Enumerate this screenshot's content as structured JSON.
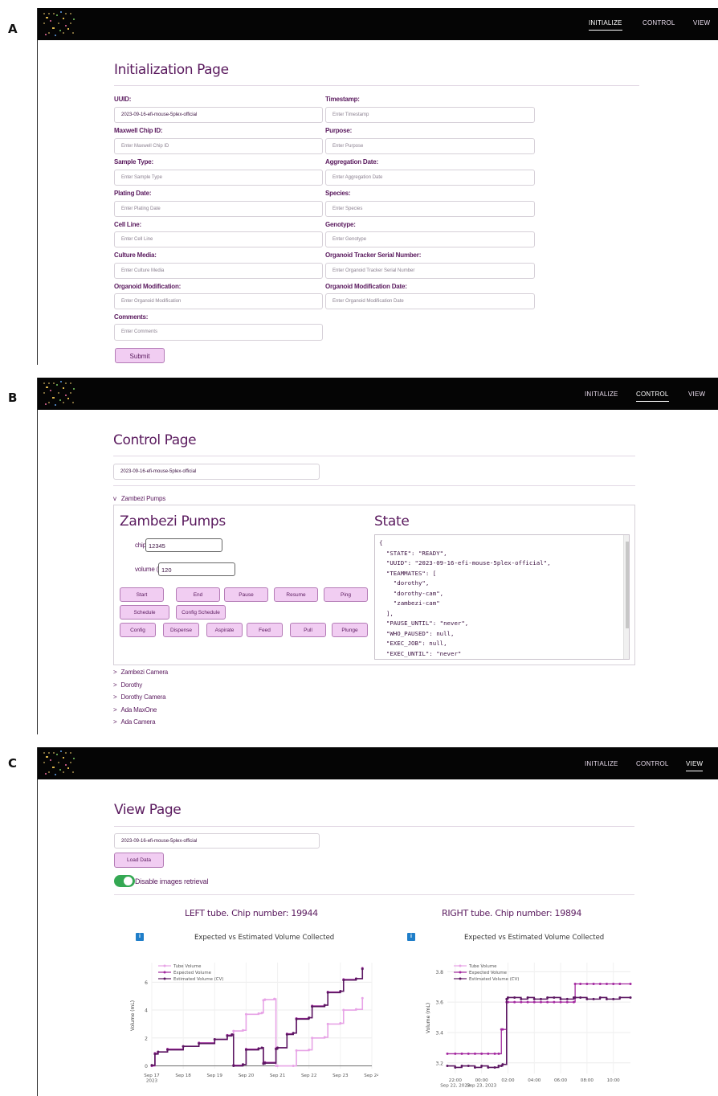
{
  "panels": {
    "a": "A",
    "b": "B",
    "c": "C"
  },
  "nav": {
    "initialize": "INITIALIZE",
    "control": "CONTROL",
    "view": "VIEW"
  },
  "init_page": {
    "title": "Initialization Page",
    "fields_left": [
      {
        "label": "UUID:",
        "value": "2023-09-16-efi-mouse-5plex-official",
        "placeholder": ""
      },
      {
        "label": "Maxwell Chip ID:",
        "value": "",
        "placeholder": "Enter Maxwell Chip ID"
      },
      {
        "label": "Sample Type:",
        "value": "",
        "placeholder": "Enter Sample Type"
      },
      {
        "label": "Plating Date:",
        "value": "",
        "placeholder": "Enter Plating Date"
      },
      {
        "label": "Cell Line:",
        "value": "",
        "placeholder": "Enter Cell Line"
      },
      {
        "label": "Culture Media:",
        "value": "",
        "placeholder": "Enter Culture Media"
      },
      {
        "label": "Organoid Modification:",
        "value": "",
        "placeholder": "Enter Organoid Modification"
      }
    ],
    "fields_right": [
      {
        "label": "Timestamp:",
        "placeholder": "Enter Timestamp"
      },
      {
        "label": "Purpose:",
        "placeholder": "Enter Purpose"
      },
      {
        "label": "Aggregation Date:",
        "placeholder": "Enter Aggregation Date"
      },
      {
        "label": "Species:",
        "placeholder": "Enter Species"
      },
      {
        "label": "Genotype:",
        "placeholder": "Enter Genotype"
      },
      {
        "label": "Organoid Tracker Serial Number:",
        "placeholder": "Enter Organoid Tracker Serial Number"
      },
      {
        "label": "Organoid Modification Date:",
        "placeholder": "Enter Organoid Modification Date"
      }
    ],
    "comments_label": "Comments:",
    "comments_placeholder": "Enter Comments",
    "submit": "Submit"
  },
  "control_page": {
    "title": "Control Page",
    "uuid": "2023-09-16-efi-mouse-5plex-official",
    "accordion_open": "Zambezi Pumps",
    "open_marker": "v",
    "closed_marker": ">",
    "pumps_title": "Zambezi Pumps",
    "chip_id_label": "chip id:",
    "chip_id_value": "12345",
    "volume_label": "volume (uL):",
    "volume_value": "120",
    "buttons_row1": [
      "Start",
      "End",
      "Pause",
      "Resume",
      "Ping"
    ],
    "buttons_row2": [
      "Schedule",
      "Config Schedule"
    ],
    "buttons_row3": [
      "Config",
      "Dispense",
      "Aspirate",
      "Feed",
      "Pull",
      "Plunge"
    ],
    "state_title": "State",
    "state_lines": [
      "{",
      "  \"STATE\": \"READY\",",
      "  \"UUID\": \"2023-09-16-efi-mouse-5plex-official\",",
      "  \"TEAMMATES\": [",
      "    \"dorothy\",",
      "    \"dorothy-cam\",",
      "    \"zambezi-cam\"",
      "  ],",
      "  \"PAUSE_UNTIL\": \"never\",",
      "  \"WHO_PAUSED\": null,",
      "  \"EXEC_JOB\": null,",
      "  \"EXEC_UNTIL\": \"never\""
    ],
    "collapsed_sections": [
      "Zambezi Camera",
      "Dorothy",
      "Dorothy Camera",
      "Ada MaxOne",
      "Ada Camera"
    ]
  },
  "view_page": {
    "title": "View Page",
    "uuid": "2023-09-16-efi-mouse-5plex-official",
    "load_button": "Load Data",
    "toggle_label": "Disable images retrieval",
    "toggle_on": true,
    "left_title": "LEFT tube. Chip number: 19944",
    "right_title": "RIGHT tube. Chip number: 19894",
    "info_glyph": "i"
  },
  "colors": {
    "brand": "#5a1a5e",
    "button_fill": "#f1cdf2",
    "toggle": "#34a853",
    "tube": "#e7a3e6",
    "expected": "#a3289f",
    "estimated": "#5c1762",
    "info": "#1f7ec9"
  },
  "chart_data": [
    {
      "type": "line",
      "title": "Expected vs Estimated Volume Collected",
      "xlabel": "",
      "ylabel": "Volume (mL)",
      "x_ticks": [
        "Sep 17\n2023",
        "Sep 18",
        "Sep 19",
        "Sep 20",
        "Sep 21",
        "Sep 22",
        "Sep 23",
        "Sep 24"
      ],
      "xlim": [
        17.0,
        24.0
      ],
      "y_ticks": [
        "0",
        "2",
        "4",
        "6"
      ],
      "ylim": [
        -0.2,
        7.4
      ],
      "grid": true,
      "legend": "top-left",
      "series": [
        {
          "name": "Tube Volume",
          "x": [
            17.0,
            17.1,
            17.2,
            17.5,
            18.0,
            18.5,
            19.0,
            19.4,
            19.55,
            19.6,
            19.9,
            20.0,
            20.4,
            20.5,
            20.55,
            20.6,
            20.9,
            20.95,
            21.0,
            21.5,
            21.6,
            22.0,
            22.1,
            22.5,
            22.6,
            23.0,
            23.1,
            23.5,
            23.7
          ],
          "y": [
            0.0,
            0.9,
            1.0,
            1.2,
            1.4,
            1.65,
            1.9,
            2.2,
            2.25,
            2.5,
            2.55,
            3.7,
            3.75,
            3.8,
            4.7,
            4.75,
            4.8,
            0.0,
            0.0,
            0.0,
            1.1,
            1.15,
            2.0,
            2.05,
            3.0,
            3.05,
            4.0,
            4.05,
            4.85
          ]
        },
        {
          "name": "Expected Volume",
          "x": [
            17.0,
            17.1,
            17.2,
            17.5,
            18.0,
            18.5,
            19.0,
            19.4,
            19.55,
            19.6,
            19.9,
            20.0,
            20.4,
            20.5,
            20.55,
            20.6,
            20.95,
            21.0,
            21.3,
            21.5,
            21.6,
            22.0,
            22.1,
            22.5,
            22.6,
            23.0,
            23.1,
            23.5,
            23.7
          ],
          "y": [
            0.0,
            0.9,
            1.0,
            1.2,
            1.4,
            1.65,
            1.9,
            2.2,
            2.25,
            0.05,
            0.1,
            1.2,
            1.25,
            1.3,
            0.2,
            0.25,
            1.25,
            1.3,
            2.3,
            2.35,
            3.4,
            3.45,
            4.3,
            4.35,
            5.3,
            5.35,
            6.2,
            6.25,
            7.0
          ]
        },
        {
          "name": "Estimated Volume (CV)",
          "x": [
            17.0,
            17.1,
            17.2,
            17.5,
            18.0,
            18.5,
            19.0,
            19.4,
            19.55,
            19.6,
            19.9,
            20.0,
            20.4,
            20.5,
            20.55,
            20.6,
            20.95,
            21.0,
            21.3,
            21.5,
            21.6,
            22.0,
            22.1,
            22.5,
            22.6,
            23.0,
            23.1,
            23.5,
            23.7
          ],
          "y": [
            0.05,
            0.85,
            1.0,
            1.15,
            1.4,
            1.6,
            1.9,
            2.15,
            2.25,
            0.0,
            0.1,
            1.15,
            1.25,
            1.3,
            0.15,
            0.2,
            1.2,
            1.3,
            2.25,
            2.35,
            3.35,
            3.45,
            4.25,
            4.35,
            5.25,
            5.35,
            6.15,
            6.25,
            6.95
          ]
        }
      ]
    },
    {
      "type": "line",
      "title": "Expected vs Estimated Volume Collected",
      "xlabel": "",
      "ylabel": "Volume (mL)",
      "x_ticks": [
        "22:00\nSep 22, 2023",
        "00:00\nSep 23, 2023",
        "02:00",
        "04:00",
        "06:00",
        "08:00",
        "10:00"
      ],
      "xlim": [
        -2.6,
        11.3
      ],
      "y_ticks": [
        "3.2",
        "3.4",
        "3.6",
        "3.8"
      ],
      "ylim": [
        3.13,
        3.86
      ],
      "grid": true,
      "legend": "top-left",
      "series": [
        {
          "name": "Tube Volume",
          "x": [],
          "y": []
        },
        {
          "name": "Expected Volume",
          "x": [
            -2.6,
            -2.0,
            -1.5,
            -1.0,
            -0.5,
            0.0,
            0.5,
            1.0,
            1.3,
            1.5,
            1.6,
            1.9,
            2.0,
            2.5,
            3.0,
            3.5,
            4.0,
            4.5,
            5.0,
            5.5,
            6.0,
            6.5,
            7.0,
            7.1,
            7.5,
            8.0,
            8.5,
            9.0,
            9.5,
            10.0,
            10.5,
            11.3
          ],
          "y": [
            3.26,
            3.26,
            3.26,
            3.26,
            3.26,
            3.26,
            3.26,
            3.26,
            3.26,
            3.42,
            3.42,
            3.6,
            3.6,
            3.6,
            3.6,
            3.6,
            3.6,
            3.6,
            3.6,
            3.6,
            3.6,
            3.6,
            3.6,
            3.72,
            3.72,
            3.72,
            3.72,
            3.72,
            3.72,
            3.72,
            3.72,
            3.72
          ]
        },
        {
          "name": "Estimated Volume (CV)",
          "x": [
            -2.6,
            -2.0,
            -1.5,
            -1.0,
            -0.5,
            0.0,
            0.5,
            1.0,
            1.3,
            1.5,
            1.6,
            1.9,
            2.0,
            2.5,
            3.0,
            3.5,
            4.0,
            4.5,
            5.0,
            5.5,
            6.0,
            6.5,
            7.0,
            7.1,
            7.5,
            8.0,
            8.5,
            9.0,
            9.5,
            10.0,
            10.5,
            11.3
          ],
          "y": [
            3.18,
            3.17,
            3.18,
            3.18,
            3.17,
            3.18,
            3.17,
            3.17,
            3.18,
            3.18,
            3.19,
            3.62,
            3.63,
            3.63,
            3.62,
            3.63,
            3.62,
            3.62,
            3.63,
            3.63,
            3.62,
            3.62,
            3.63,
            3.63,
            3.63,
            3.62,
            3.62,
            3.63,
            3.62,
            3.62,
            3.63,
            3.63
          ]
        }
      ]
    }
  ]
}
